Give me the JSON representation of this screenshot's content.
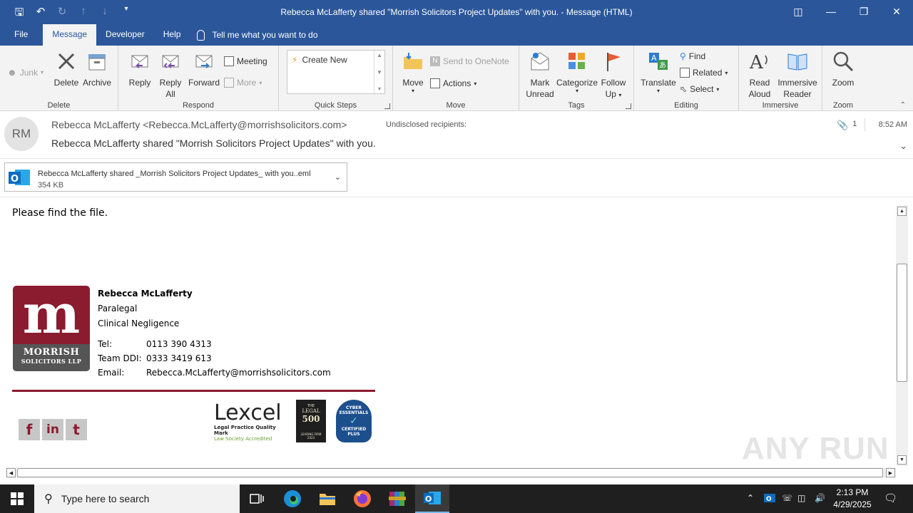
{
  "window": {
    "title": "Rebecca McLafferty shared \"Morrish Solicitors Project Updates\" with you.  -  Message (HTML)"
  },
  "menu": {
    "tabs": [
      "File",
      "Message",
      "Developer",
      "Help"
    ],
    "active_tab": "Message",
    "tell_me": "Tell me what you want to do"
  },
  "ribbon": {
    "delete": {
      "junk": "Junk",
      "delete": "Delete",
      "archive": "Archive",
      "label": "Delete"
    },
    "respond": {
      "reply": "Reply",
      "reply_all_1": "Reply",
      "reply_all_2": "All",
      "forward": "Forward",
      "meeting": "Meeting",
      "more": "More",
      "label": "Respond"
    },
    "quick_steps": {
      "create_new": "Create New",
      "label": "Quick Steps"
    },
    "move": {
      "move": "Move",
      "send_onenote": "Send to OneNote",
      "actions": "Actions",
      "label": "Move"
    },
    "tags": {
      "mark_unread_1": "Mark",
      "mark_unread_2": "Unread",
      "categorize": "Categorize",
      "follow_up_1": "Follow",
      "follow_up_2": "Up",
      "label": "Tags"
    },
    "editing": {
      "translate": "Translate",
      "find": "Find",
      "related": "Related",
      "select": "Select",
      "label": "Editing"
    },
    "immersive": {
      "read_aloud_1": "Read",
      "read_aloud_2": "Aloud",
      "immersive_reader_1": "Immersive",
      "immersive_reader_2": "Reader",
      "label": "Immersive"
    },
    "zoom": {
      "zoom": "Zoom",
      "label": "Zoom"
    }
  },
  "message": {
    "avatar_initials": "RM",
    "from": "Rebecca McLafferty <Rebecca.McLafferty@morrishsolicitors.com>",
    "recipients": "Undisclosed recipients:",
    "attachment_count": "1",
    "time": "8:52 AM",
    "subject": "Rebecca McLafferty shared \"Morrish Solicitors Project Updates\" with you."
  },
  "attachment": {
    "name": "Rebecca McLafferty shared _Morrish Solicitors Project Updates_ with you..eml",
    "size": "354 KB"
  },
  "body": {
    "greeting": "Please find the file.",
    "logo_letter": "m",
    "logo_line1": "MORRISH",
    "logo_line2": "SOLICITORS LLP",
    "signature": {
      "name": "Rebecca McLafferty",
      "role": "Paralegal",
      "department": "Clinical Negligence",
      "tel_label": "Tel:",
      "tel": "0113 390 4313",
      "ddi_label": "Team DDI:",
      "ddi": "0333 3419 613",
      "email_label": "Email:",
      "email": "Rebecca.McLafferty@morrishsolicitors.com"
    },
    "social": [
      "f",
      "in",
      "t"
    ],
    "badges": {
      "lexcel": "Lexcel",
      "lexcel_sub1": "Legal Practice Quality Mark",
      "lexcel_sub2": "Law Society Accredited",
      "legal500_1": "THE",
      "legal500_2": "LEGAL",
      "legal500_3": "500",
      "legal500_4": "LEADING FIRM",
      "legal500_5": "2023",
      "cyber_1": "CYBER",
      "cyber_2": "ESSENTIALS",
      "cyber_3": "CERTIFIED",
      "cyber_4": "PLUS"
    }
  },
  "watermark": "ANY RUN",
  "taskbar": {
    "search_placeholder": "Type here to search",
    "time": "2:13 PM",
    "date": "4/29/2025"
  },
  "colors": {
    "outlook_blue": "#2b579a",
    "morrish_red": "#8b1b2e"
  }
}
